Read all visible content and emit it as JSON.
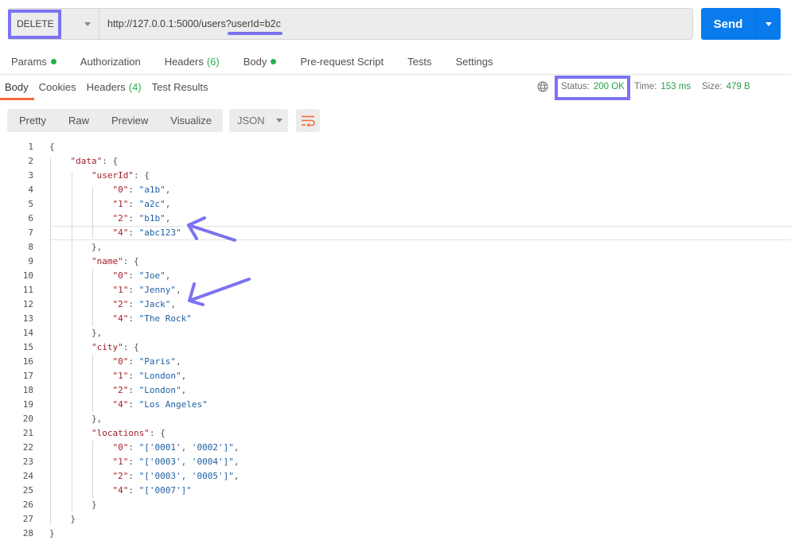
{
  "request": {
    "method": "DELETE",
    "url": "http://127.0.0.1:5000/users?userId=b2c",
    "send_label": "Send"
  },
  "request_tabs": [
    {
      "label": "Params",
      "dot": true
    },
    {
      "label": "Authorization"
    },
    {
      "label": "Headers",
      "count": "(6)"
    },
    {
      "label": "Body",
      "dot": true
    },
    {
      "label": "Pre-request Script"
    },
    {
      "label": "Tests"
    },
    {
      "label": "Settings"
    }
  ],
  "response_tabs": [
    {
      "label": "Body",
      "active": true
    },
    {
      "label": "Cookies"
    },
    {
      "label": "Headers",
      "count": "(4)"
    },
    {
      "label": "Test Results"
    }
  ],
  "response_meta": {
    "status_label": "Status:",
    "status_value": "200 OK",
    "time_label": "Time:",
    "time_value": "153 ms",
    "size_label": "Size:",
    "size_value": "479 B"
  },
  "view_options": [
    "Pretty",
    "Raw",
    "Preview",
    "Visualize"
  ],
  "format": "JSON",
  "colors": {
    "accent": "#097bed",
    "success": "#26a147",
    "active_tab": "#f26b3a",
    "annotation": "#7b73f0",
    "json_key": "#a3212a",
    "json_string": "#1f5fa3"
  },
  "code_lines": [
    "{",
    "    \"data\": {",
    "        \"userId\": {",
    "            \"0\": \"a1b\",",
    "            \"1\": \"a2c\",",
    "            \"2\": \"b1b\",",
    "            \"4\": \"abc123\"",
    "        },",
    "        \"name\": {",
    "            \"0\": \"Joe\",",
    "            \"1\": \"Jenny\",",
    "            \"2\": \"Jack\",",
    "            \"4\": \"The Rock\"",
    "        },",
    "        \"city\": {",
    "            \"0\": \"Paris\",",
    "            \"1\": \"London\",",
    "            \"2\": \"London\",",
    "            \"4\": \"Los Angeles\"",
    "        },",
    "        \"locations\": {",
    "            \"0\": \"['0001', '0002']\",",
    "            \"1\": \"['0003', '0004']\",",
    "            \"2\": \"['0003', '0005']\",",
    "            \"4\": \"['0007']\"",
    "        }",
    "    }",
    "}"
  ]
}
